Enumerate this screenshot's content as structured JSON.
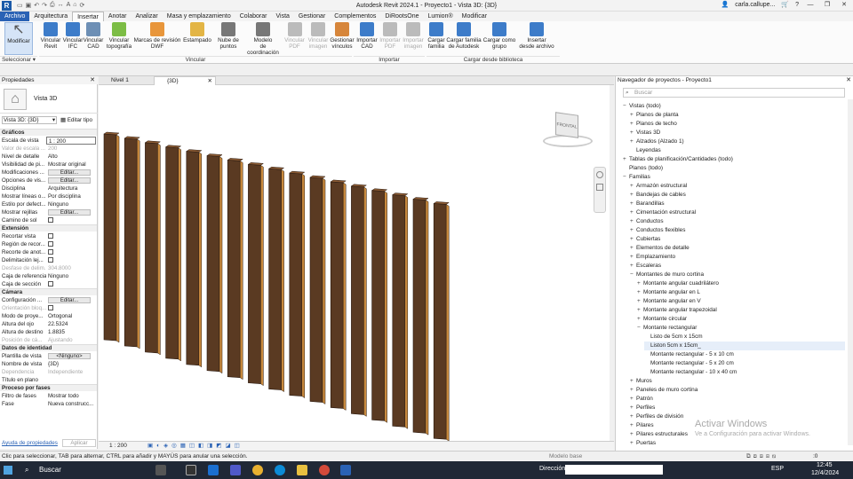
{
  "titlebar": {
    "title": "Autodesk Revit 2024.1 - Proyecto1 - Vista 3D: {3D}",
    "user": "carla.callupe...",
    "logo": "R"
  },
  "tabs": [
    "Archivo",
    "Arquitectura",
    "Insertar",
    "Anotar",
    "Analizar",
    "Masa y emplazamiento",
    "Colaborar",
    "Vista",
    "Gestionar",
    "Complementos",
    "DiRootsOne",
    "Lumion®",
    "Modificar"
  ],
  "active_tab": "Insertar",
  "ribbon": {
    "modificar": "Modificar",
    "seleccionar": "Seleccionar",
    "buttons": [
      {
        "label": "Vincular\nRevit",
        "color": "#3d7cc9"
      },
      {
        "label": "Vincular\nIFC",
        "color": "#3d7cc9"
      },
      {
        "label": "Vincular\nCAD",
        "color": "#6d8fb5"
      },
      {
        "label": "Vincular\ntopografía",
        "color": "#7cbd45"
      },
      {
        "label": "Marcas de revisión\nDWF",
        "color": "#e8963b"
      },
      {
        "label": "Estampado",
        "color": "#e3b545"
      },
      {
        "label": "Nube de\npuntos",
        "color": "#777"
      },
      {
        "label": "Modelo\nde coordinación",
        "color": "#777"
      },
      {
        "label": "Vincular\nPDF",
        "color": "#bbb"
      },
      {
        "label": "Vincular\nimagen",
        "color": "#bbb"
      },
      {
        "label": "Gestionar\nvínculos",
        "color": "#d7863b"
      },
      {
        "label": "Importar\nCAD",
        "color": "#3d7cc9"
      },
      {
        "label": "Importar\nPDF",
        "color": "#bbb"
      },
      {
        "label": "Importar\nimagen",
        "color": "#bbb"
      },
      {
        "label": "Cargar\nfamilia",
        "color": "#3d7cc9"
      },
      {
        "label": "Cargar familia\nde Autodesk",
        "color": "#3d7cc9"
      },
      {
        "label": "Cargar como\ngrupo",
        "color": "#3d7cc9"
      },
      {
        "label": "Insertar\ndesde archivo",
        "color": "#3d7cc9"
      }
    ],
    "panels": {
      "vincular": "Vincular",
      "importar": "Importar",
      "biblioteca": "Cargar desde biblioteca"
    }
  },
  "properties": {
    "title": "Propiedades",
    "type_name": "Vista 3D",
    "view_selector": "Vista 3D: {3D}",
    "edit_type": "Editar tipo",
    "sections": {
      "graficos": "Gráficos",
      "extension": "Extensión",
      "camara": "Cámara",
      "identidad": "Datos de identidad",
      "fases": "Proceso por fases"
    },
    "graficos": [
      {
        "k": "Escala de vista",
        "v": "1 : 200"
      },
      {
        "k": "Valor de escala ...",
        "v": "200"
      },
      {
        "k": "Nivel de detalle",
        "v": "Alto"
      },
      {
        "k": "Visibilidad de pi...",
        "v": "Mostrar original"
      },
      {
        "k": "Modificaciones ...",
        "v": "Editar..."
      },
      {
        "k": "Opciones de vis...",
        "v": "Editar..."
      },
      {
        "k": "Disciplina",
        "v": "Arquitectura"
      },
      {
        "k": "Mostrar líneas o...",
        "v": "Por disciplina"
      },
      {
        "k": "Estilo por defect...",
        "v": "Ninguno"
      },
      {
        "k": "Mostrar rejillas",
        "v": "Editar..."
      },
      {
        "k": "Camino de sol",
        "v": ""
      }
    ],
    "extension": [
      {
        "k": "Recortar vista",
        "v": ""
      },
      {
        "k": "Región de recor...",
        "v": ""
      },
      {
        "k": "Recorte de anot...",
        "v": ""
      },
      {
        "k": "Delimitación lej...",
        "v": ""
      },
      {
        "k": "Desfase de delim...",
        "v": "304.8000"
      },
      {
        "k": "Caja de referencia",
        "v": "Ninguno"
      },
      {
        "k": "Caja de sección",
        "v": ""
      }
    ],
    "camara": [
      {
        "k": "Configuración ...",
        "v": "Editar..."
      },
      {
        "k": "Orientación bloq...",
        "v": ""
      },
      {
        "k": "Modo de proye...",
        "v": "Ortogonal"
      },
      {
        "k": "Altura del ojo",
        "v": "22.5324"
      },
      {
        "k": "Altura de destino",
        "v": "1.8835"
      },
      {
        "k": "Posición de cá...",
        "v": "Ajustando"
      }
    ],
    "identidad": [
      {
        "k": "Plantilla de vista",
        "v": "<Ninguno>"
      },
      {
        "k": "Nombre de vista",
        "v": "{3D}"
      },
      {
        "k": "Dependencia",
        "v": "Independiente"
      },
      {
        "k": "Título en plano",
        "v": ""
      }
    ],
    "fases": [
      {
        "k": "Filtro de fases",
        "v": "Mostrar todo"
      },
      {
        "k": "Fase",
        "v": "Nueva construcc..."
      }
    ],
    "help_link": "Ayuda de propiedades",
    "apply": "Aplicar"
  },
  "view_tabs": [
    "Nivel 1",
    "{3D}"
  ],
  "viewcube_label": "FRONTAL",
  "viewbar": {
    "scale": "1 : 200"
  },
  "browser": {
    "title": "Navegador de proyectos - Proyecto1",
    "search_placeholder": "Buscar",
    "items": [
      {
        "t": "Vistas (todo)",
        "d": 0,
        "e": "−"
      },
      {
        "t": "Planos de planta",
        "d": 1,
        "e": "+"
      },
      {
        "t": "Planos de techo",
        "d": 1,
        "e": "+"
      },
      {
        "t": "Vistas 3D",
        "d": 1,
        "e": "+"
      },
      {
        "t": "Alzados (Alzado 1)",
        "d": 1,
        "e": "+"
      },
      {
        "t": "Leyendas",
        "d": 1,
        "e": ""
      },
      {
        "t": "Tablas de planificación/Cantidades (todo)",
        "d": 0,
        "e": "+"
      },
      {
        "t": "Planos (todo)",
        "d": 0,
        "e": ""
      },
      {
        "t": "Familias",
        "d": 0,
        "e": "−"
      },
      {
        "t": "Armazón estructural",
        "d": 1,
        "e": "+"
      },
      {
        "t": "Bandejas de cables",
        "d": 1,
        "e": "+"
      },
      {
        "t": "Barandillas",
        "d": 1,
        "e": "+"
      },
      {
        "t": "Cimentación estructural",
        "d": 1,
        "e": "+"
      },
      {
        "t": "Conductos",
        "d": 1,
        "e": "+"
      },
      {
        "t": "Conductos flexibles",
        "d": 1,
        "e": "+"
      },
      {
        "t": "Cubiertas",
        "d": 1,
        "e": "+"
      },
      {
        "t": "Elementos de detalle",
        "d": 1,
        "e": "+"
      },
      {
        "t": "Emplazamiento",
        "d": 1,
        "e": "+"
      },
      {
        "t": "Escaleras",
        "d": 1,
        "e": "+"
      },
      {
        "t": "Montantes de muro cortina",
        "d": 1,
        "e": "−"
      },
      {
        "t": "Montante angular cuadrilátero",
        "d": 2,
        "e": "+"
      },
      {
        "t": "Montante angular en L",
        "d": 2,
        "e": "+"
      },
      {
        "t": "Montante angular en V",
        "d": 2,
        "e": "+"
      },
      {
        "t": "Montante angular trapezoidal",
        "d": 2,
        "e": "+"
      },
      {
        "t": "Montante circular",
        "d": 2,
        "e": "+"
      },
      {
        "t": "Montante rectangular",
        "d": 2,
        "e": "−"
      },
      {
        "t": "Listo de 5cm x 15cm",
        "d": 3,
        "e": ""
      },
      {
        "t": "Liston 5cm x 15cm_",
        "d": 3,
        "e": "",
        "sel": true
      },
      {
        "t": "Montante rectangular - 5 x 10 cm",
        "d": 3,
        "e": ""
      },
      {
        "t": "Montante rectangular - 5 x 20 cm",
        "d": 3,
        "e": ""
      },
      {
        "t": "Montante rectangular - 10 x 40 cm",
        "d": 3,
        "e": ""
      },
      {
        "t": "Muros",
        "d": 1,
        "e": "+"
      },
      {
        "t": "Paneles de muro cortina",
        "d": 1,
        "e": "+"
      },
      {
        "t": "Patrón",
        "d": 1,
        "e": "+"
      },
      {
        "t": "Perfiles",
        "d": 1,
        "e": "+"
      },
      {
        "t": "Perfiles de división",
        "d": 1,
        "e": "+"
      },
      {
        "t": "Pilares",
        "d": 1,
        "e": "+"
      },
      {
        "t": "Pilares estructurales",
        "d": 1,
        "e": "+"
      },
      {
        "t": "Puertas",
        "d": 1,
        "e": "+"
      }
    ]
  },
  "watermark": {
    "line1": "Activar Windows",
    "line2": "Ve a Configuración para activar Windows."
  },
  "status": {
    "hint": "Clic para seleccionar, TAB para alternar, CTRL para añadir y MAYÚS para anular una selección.",
    "model": "Modelo base",
    "selection_count": ":0"
  },
  "taskbar": {
    "search": "Buscar",
    "direccion": "Dirección",
    "lang": "ESP",
    "time": "12:45",
    "date": "12/4/2024"
  },
  "colors": {
    "wood": "#5a3a22",
    "wood_edge": "#c98a3e",
    "ribbon_blue": "#2a62b5"
  }
}
